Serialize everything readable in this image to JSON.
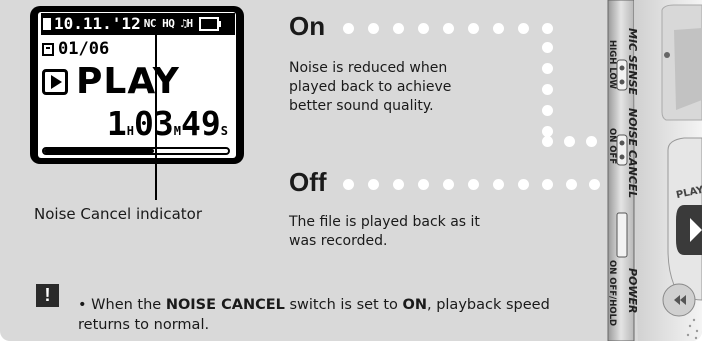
{
  "lcd": {
    "date": "10.11.'12",
    "status_tags": "NC HQ ♫H",
    "file": "01/06",
    "mode": "PLAY",
    "hour": "1",
    "hour_unit": "H",
    "minutes": "03",
    "minute_unit": "M",
    "seconds": "49",
    "second_unit": "S",
    "progress_fraction": 0.6
  },
  "indicator_label": "Noise Cancel indicator",
  "on_section": {
    "title": "On",
    "description": "Noise is reduced when played back to achieve better sound quality."
  },
  "off_section": {
    "title": "Off",
    "description": "The file is played back as it was recorded."
  },
  "note": {
    "icon": "!",
    "bullet": "•",
    "text_before": "When the ",
    "bold_switch": "NOISE CANCEL",
    "text_middle": " switch is set to ",
    "bold_state": "ON",
    "text_after": ", playback speed returns to normal."
  },
  "device": {
    "mic_sense_label": "MIC SENSE",
    "mic_sense_options": "HIGH LOW",
    "noise_cancel_label": "NOISE CANCEL",
    "noise_cancel_options": "ON OFF",
    "power_label": "POWER",
    "power_options": "ON OFF/HOLD",
    "play_label": "PLAY/"
  },
  "colors": {
    "panel_bg": "#d9d9d9",
    "dots": "#ffffff",
    "text": "#1a1a1a"
  }
}
